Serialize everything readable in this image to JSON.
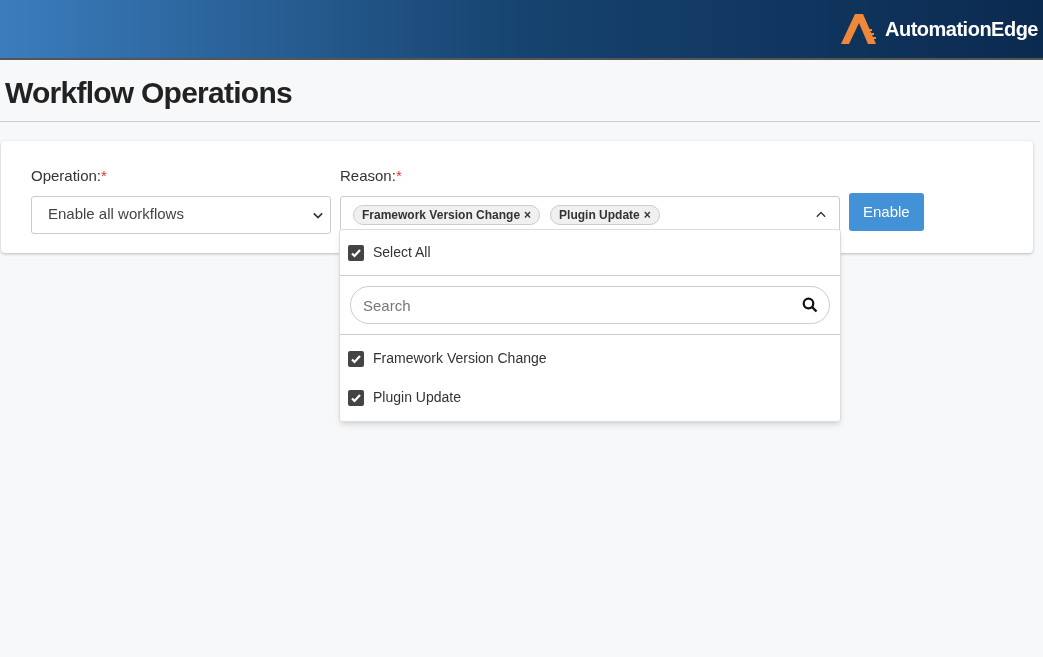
{
  "header": {
    "logo_text": "AutomationEdge"
  },
  "page_title": "Workflow Operations",
  "form": {
    "operation": {
      "label": "Operation:",
      "required_mark": "*",
      "value": "Enable all workflows"
    },
    "reason": {
      "label": "Reason:",
      "required_mark": "*",
      "expanded": true,
      "tags": [
        {
          "label": "Framework Version Change",
          "remove": "×"
        },
        {
          "label": "Plugin Update",
          "remove": "×"
        }
      ]
    },
    "button": "Enable"
  },
  "dropdown": {
    "select_all": {
      "label": "Select All",
      "checked": true
    },
    "search": {
      "placeholder": "Search"
    },
    "options": [
      {
        "label": "Framework Version Change",
        "checked": true
      },
      {
        "label": "Plugin Update",
        "checked": true
      }
    ]
  }
}
